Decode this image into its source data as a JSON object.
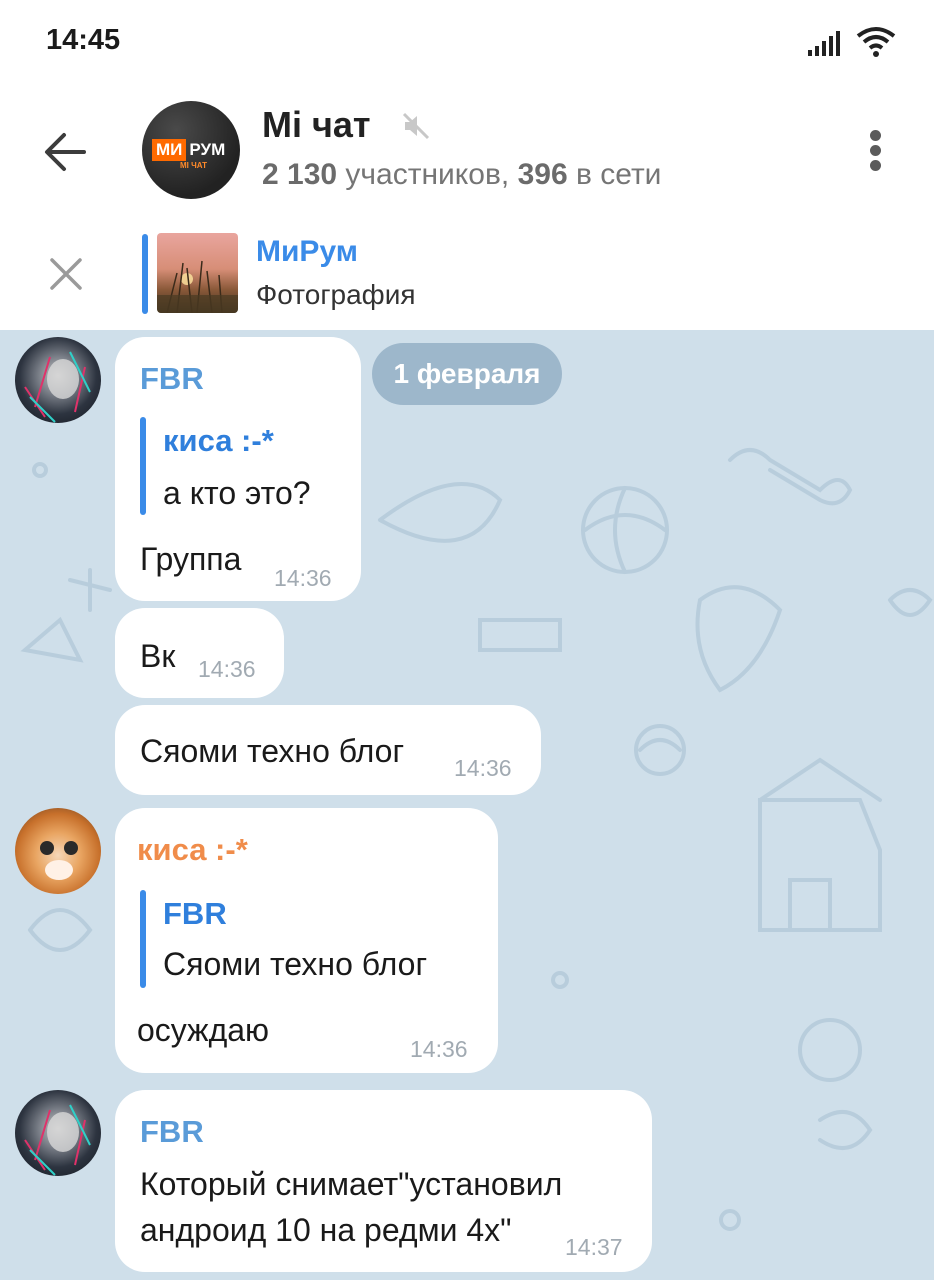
{
  "status_bar": {
    "time": "14:45",
    "icons": [
      "signal-icon",
      "wifi-icon"
    ]
  },
  "header": {
    "title": "Mi чат",
    "members": "2 130",
    "members_word": "участников,",
    "online": "396",
    "online_word": "в сети",
    "logo_text_1": "МИ",
    "logo_text_2": "РУМ",
    "logo_sub": "MI ЧАТ"
  },
  "pinned": {
    "title": "МиРум",
    "text": "Фотография"
  },
  "chat": {
    "date": "1 февраля",
    "messages": [
      {
        "sender": "FBR",
        "reply_to_name": "киса :-*",
        "reply_to_text": "а кто это?",
        "text": "Группа",
        "time": "14:36"
      },
      {
        "text": "Вк",
        "time": "14:36"
      },
      {
        "text": "Сяоми техно блог",
        "time": "14:36"
      },
      {
        "sender": "киса :-*",
        "reply_to_name": "FBR",
        "reply_to_text": "Сяоми техно блог",
        "text": "осуждаю",
        "time": "14:36"
      },
      {
        "sender": "FBR",
        "text_line1": "Который снимает\"установил",
        "text_line2": "андроид 10 на редми 4х\"",
        "time": "14:37"
      }
    ]
  },
  "colors": {
    "accent": "#3a8be8",
    "fbr_name": "#5a9bd8",
    "kisa_name": "#f08c4a",
    "chat_bg": "#cfdfea"
  }
}
